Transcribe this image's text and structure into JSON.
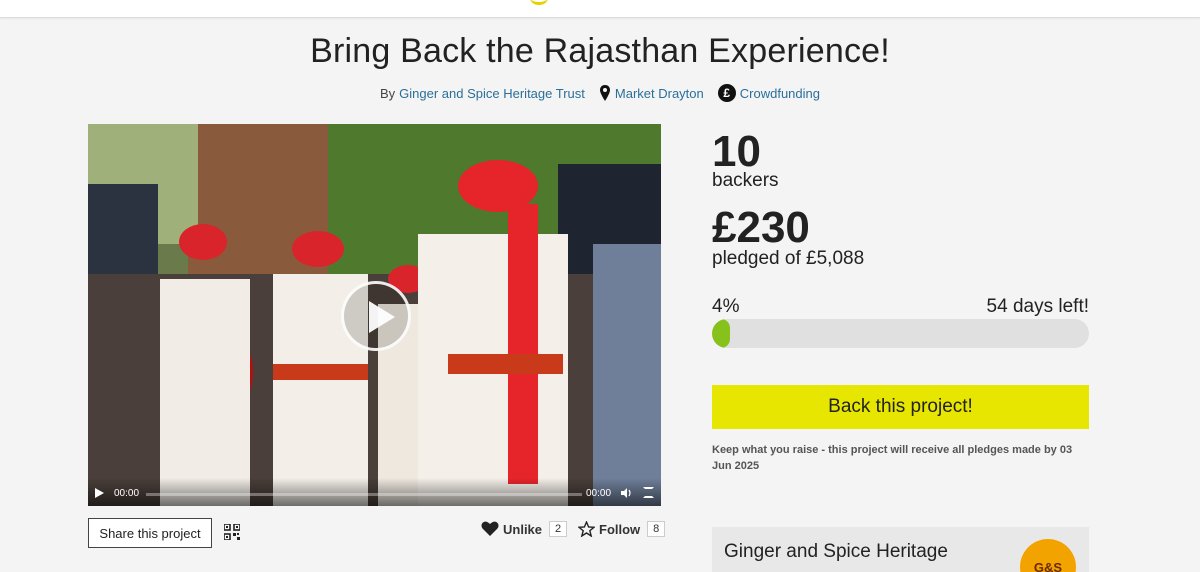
{
  "project": {
    "title": "Bring Back the Rajasthan Experience!",
    "by_prefix": "By",
    "creator": "Ginger and Spice Heritage Trust",
    "location": "Market Drayton",
    "category": "Crowdfunding"
  },
  "video": {
    "time_current": "00:00",
    "time_total": "00:00"
  },
  "actions": {
    "share_label": "Share this project",
    "unlike_label": "Unlike",
    "unlike_count": "2",
    "follow_label": "Follow",
    "follow_count": "8"
  },
  "stats": {
    "backers_value": "10",
    "backers_label": "backers",
    "pledged_value": "£230",
    "pledged_label": "pledged of £5,088",
    "percent_label": "4%",
    "progress_fraction": 0.045,
    "days_left": "54 days left!"
  },
  "cta": {
    "back_label": "Back this project!",
    "note": "Keep what you raise - this project will receive all pledges made by 03 Jun 2025"
  },
  "creator_card": {
    "name": "Ginger and Spice Heritage",
    "avatar_text": "G&S"
  },
  "colors": {
    "accent_yellow": "#e6e600",
    "progress_green": "#86c21b",
    "link_blue": "#2a6f9a"
  },
  "icons": [
    "map-pin-icon",
    "pound-icon",
    "play-icon",
    "volume-icon",
    "fullscreen-icon",
    "qr-code-icon",
    "heart-icon",
    "star-icon"
  ]
}
